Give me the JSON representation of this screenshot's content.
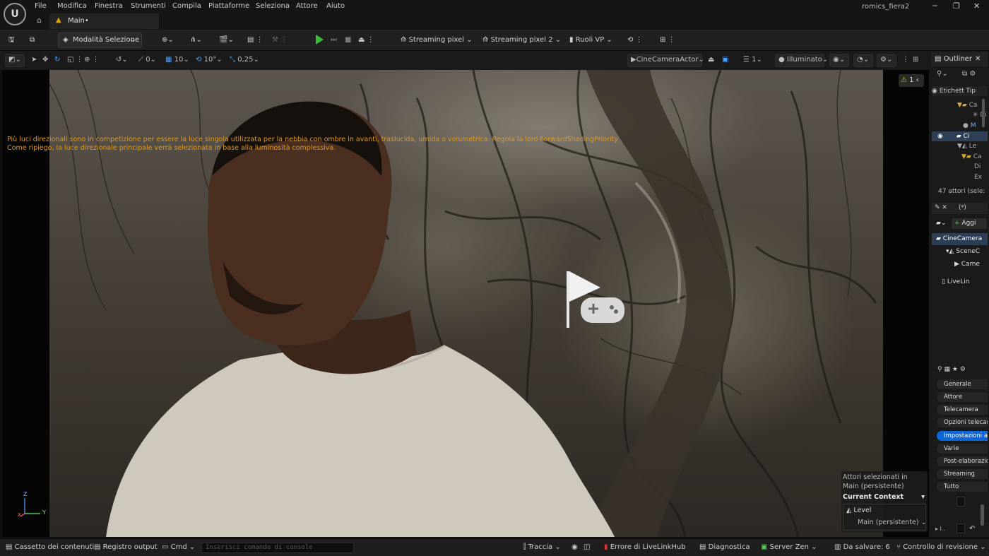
{
  "menubar": {
    "logo": "U",
    "items": [
      "File",
      "Modifica",
      "Finestra",
      "Strumenti",
      "Compila",
      "Piattaforme",
      "Seleziona",
      "Attore",
      "Aiuto"
    ],
    "project_name": "romics_fiera2"
  },
  "tabs": {
    "main_label": "Main•"
  },
  "toolbar": {
    "mode_label": "Modalità Selezione",
    "streaming1": "Streaming pixel",
    "streaming2": "Streaming pixel 2",
    "roles": "Ruoli VP"
  },
  "viewport_toolbar": {
    "rotate_snap": "0",
    "grid_snap": "10",
    "angle_snap": "10°",
    "scale_snap": "0,25",
    "camera": "CineCameraActor",
    "layers": "1",
    "view_mode": "Illuminato"
  },
  "viewport": {
    "warning_line1": "Più luci direzionali sono in competizione per essere la luce singola utilizzata per la nebbia con ombre in avanti, traslucida, umida o volumetrica. Regola la loro ForwardShadingPriority",
    "warning_line2": "Come ripiego, la luce direzionale principale verrà selezionata in base alla luminosità complessiva.",
    "warning_count": "1",
    "axis_z": "Z",
    "axis_y": "Y",
    "axis_x": "X",
    "context": {
      "title_line1": "Attori selezionati in",
      "title_line2": "Main (persistente)",
      "header": "Current Context",
      "level_label": "Level",
      "level_value": "Main (persistente)"
    }
  },
  "outliner": {
    "tab": "Outliner",
    "column": "Etichett Tip",
    "rows": [
      "Ca",
      "Di",
      "M",
      "Ci",
      "Le",
      "Ca",
      "Di",
      "Ex"
    ],
    "actor_count": "47 attori (sele:"
  },
  "details": {
    "add_label": "Aggi",
    "components": [
      "CineCamera",
      "SceneC",
      "Came",
      "LiveLin"
    ],
    "categories": [
      "Generale",
      "Attore",
      "Telecamera",
      "Opzioni telecam",
      "Impostazioni att",
      "Varie",
      "Post-elaborazio",
      "Streaming",
      "Tutto"
    ],
    "selected_category": "Impostazioni att"
  },
  "statusbar": {
    "content_drawer": "Cassetto dei contenuti",
    "output_log": "Registro output",
    "cmd": "Cmd",
    "console_placeholder": "Inserisci comando di console",
    "trace": "Traccia",
    "livelink_error": "Errore di LiveLinkHub",
    "diagnostics": "Diagnostica",
    "server": "Server Zen",
    "to_save": "Da salvare: 6",
    "revision": "Controllo di revisione"
  },
  "colors": {
    "accent_blue": "#0d66d8",
    "play_green": "#36c03a",
    "warning_orange": "#e09a1c"
  }
}
